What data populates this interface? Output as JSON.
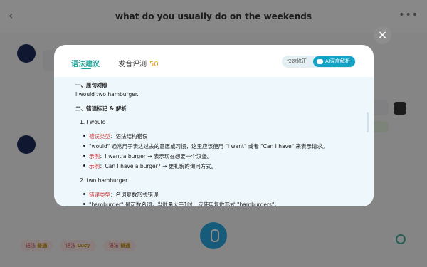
{
  "header": {
    "title": "what do you usually do on the weekends"
  },
  "chips": [
    {
      "text": "语法 ",
      "highlight": "普通"
    },
    {
      "text": "语法 ",
      "highlight": "Lucy"
    },
    {
      "text": "语法 ",
      "highlight": "普通"
    }
  ],
  "modal": {
    "tabs": {
      "grammar": "语法建议",
      "pronunciation": "发音评测",
      "score": "50"
    },
    "mode": {
      "quick": "快速修正",
      "ai": "AI深度解析"
    },
    "section1": {
      "title": "一、原句对照",
      "sentence": "I would two hamburger."
    },
    "section2": {
      "title": "二、错误标记 & 解析",
      "items": [
        {
          "heading": "1.  I would",
          "type_label": "错误类型",
          "type_value": "：语法结构错误",
          "explain": "\"would\" 通常用于表达过去的意愿或习惯，这里应该使用 \"I want\" 或者 \"Can I have\" 来表示请求。",
          "ex1_label": "示例",
          "ex1_value": "：I want a burger → 表示现在想要一个汉堡。",
          "ex2_label": "示例",
          "ex2_value": "：Can I have a burger? → 更礼貌的询问方式。"
        },
        {
          "heading": "2.  two hamburger",
          "type_label": "错误类型",
          "type_value": "：名词复数形式错误",
          "explain_partial": "\"hamburger\" 是可数名词，当数量大于1时，应使用复数形式 \"hamburgers\"。"
        }
      ]
    }
  }
}
